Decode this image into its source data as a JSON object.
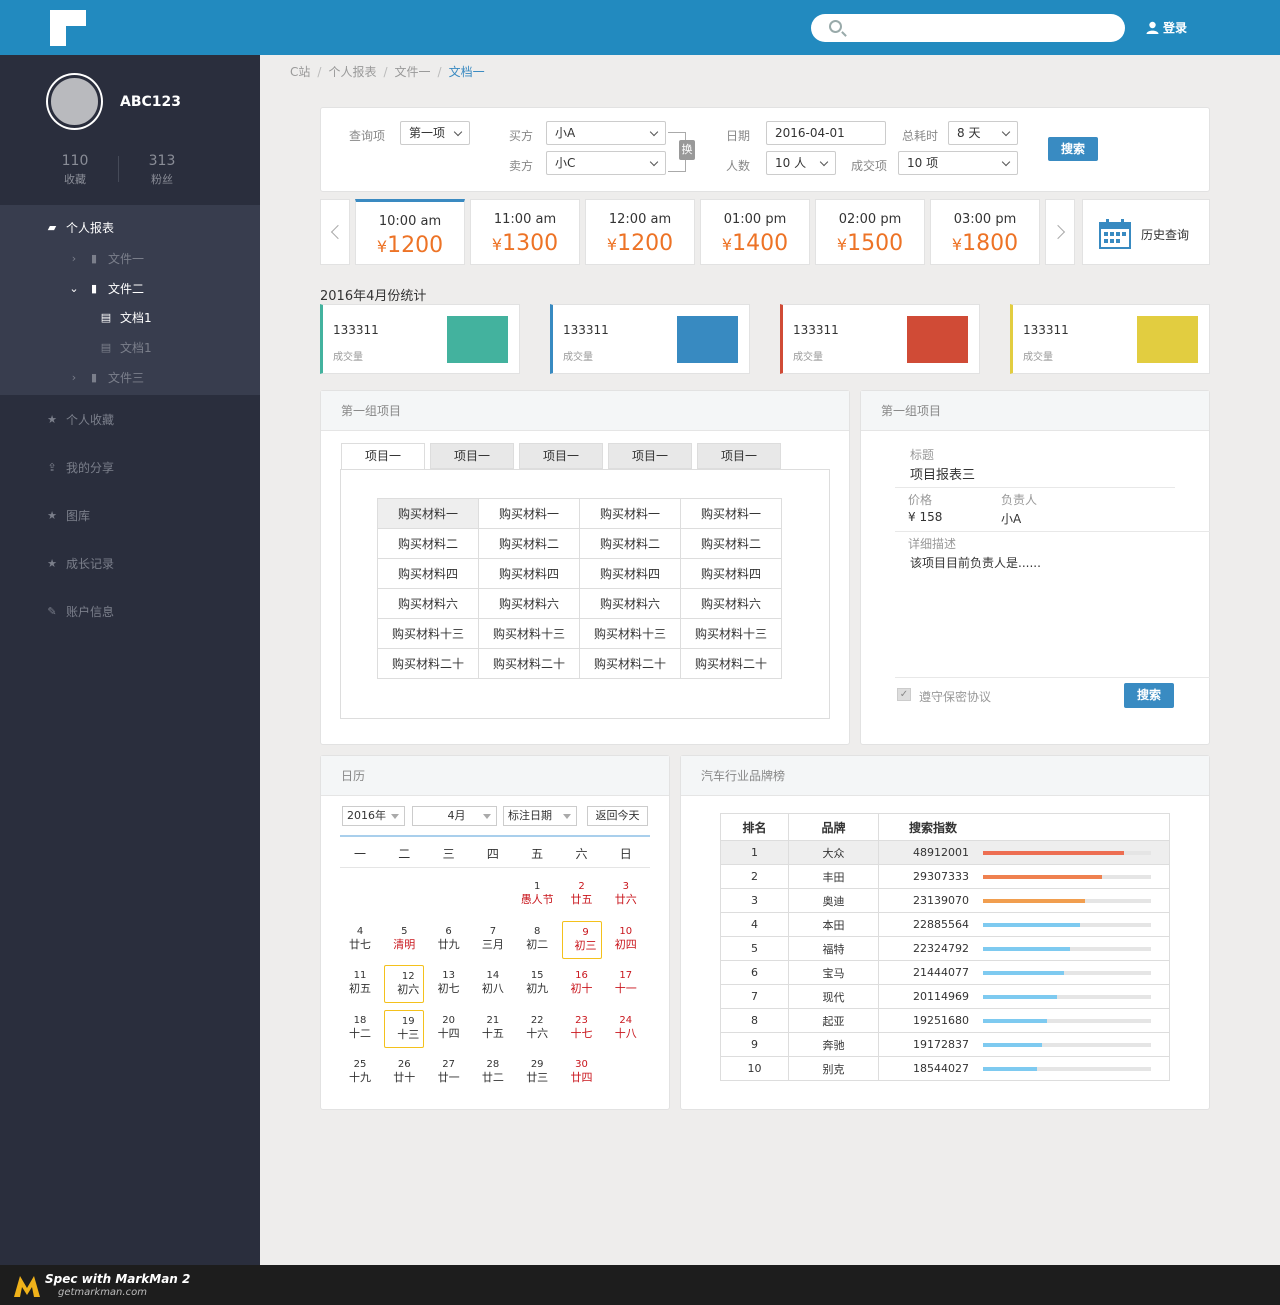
{
  "header": {
    "login_label": "登录",
    "search_placeholder": ""
  },
  "sidebar": {
    "username": "ABC123",
    "stats": [
      {
        "value": "110",
        "label": "收藏"
      },
      {
        "value": "313",
        "label": "粉丝"
      }
    ],
    "menu": {
      "report": "个人报表",
      "file1": "文件一",
      "file2": "文件二",
      "doc1": "文档1",
      "doc2": "文档1",
      "file3": "文件三",
      "favorites": "个人收藏",
      "share": "我的分享",
      "gallery": "图库",
      "growth": "成长记录",
      "account": "账户信息"
    }
  },
  "breadcrumb": {
    "items": [
      "C站",
      "个人报表",
      "文件一"
    ],
    "current": "文档一"
  },
  "query": {
    "label_query": "查询项",
    "query_value": "第一项",
    "label_buyer": "买方",
    "buyer_value": "小A",
    "label_seller": "卖方",
    "seller_value": "小C",
    "swap_label": "换",
    "label_date": "日期",
    "date_value": "2016-04-01",
    "label_duration": "总耗时",
    "duration_value": "8 天",
    "label_people": "人数",
    "people_value": "10 人",
    "label_deals": "成交项",
    "deals_value": "10 项",
    "search_label": "搜索"
  },
  "time_slots": [
    {
      "time": "10:00 am",
      "price": "1200"
    },
    {
      "time": "11:00 am",
      "price": "1300"
    },
    {
      "time": "12:00 am",
      "price": "1200"
    },
    {
      "time": "01:00 pm",
      "price": "1400"
    },
    {
      "time": "02:00 pm",
      "price": "1500"
    },
    {
      "time": "03:00 pm",
      "price": "1800"
    }
  ],
  "currency": "¥",
  "history_label": "历史查询",
  "stats_title": "2016年4月份统计",
  "stat_cards": [
    {
      "value": "133311",
      "label": "成交量",
      "color": "#43b29e"
    },
    {
      "value": "133311",
      "label": "成交量",
      "color": "#388ac1"
    },
    {
      "value": "133311",
      "label": "成交量",
      "color": "#d04b36"
    },
    {
      "value": "133311",
      "label": "成交量",
      "color": "#e2cd40"
    }
  ],
  "group1": {
    "title": "第一组项目",
    "tabs": [
      "项目一",
      "项目一",
      "项目一",
      "项目一",
      "项目一"
    ],
    "rows": [
      [
        "购买材料一",
        "购买材料一",
        "购买材料一",
        "购买材料一"
      ],
      [
        "购买材料二",
        "购买材料二",
        "购买材料二",
        "购买材料二"
      ],
      [
        "购买材料四",
        "购买材料四",
        "购买材料四",
        "购买材料四"
      ],
      [
        "购买材料六",
        "购买材料六",
        "购买材料六",
        "购买材料六"
      ],
      [
        "购买材料十三",
        "购买材料十三",
        "购买材料十三",
        "购买材料十三"
      ],
      [
        "购买材料二十",
        "购买材料二十",
        "购买材料二十",
        "购买材料二十"
      ]
    ]
  },
  "group2": {
    "title": "第一组项目",
    "label_title": "标题",
    "title_value": "项目报表三",
    "label_price": "价格",
    "price_value": "¥ 158",
    "label_owner": "负责人",
    "owner_value": "小A",
    "label_desc": "详细描述",
    "desc_value": "该项目目前负责人是......",
    "agree_label": "遵守保密协议",
    "search_label": "搜索"
  },
  "calendar": {
    "title": "日历",
    "year": "2016年",
    "month": "4月",
    "mark": "标注日期",
    "today": "返回今天",
    "weekdays": [
      "一",
      "二",
      "三",
      "四",
      "五",
      "六",
      "日"
    ],
    "weeks": [
      [
        null,
        null,
        null,
        null,
        {
          "d": "1",
          "l": "愚人节",
          "fest": true
        },
        {
          "d": "2",
          "l": "廿五",
          "red": true
        },
        {
          "d": "3",
          "l": "廿六",
          "red": true
        }
      ],
      [
        {
          "d": "4",
          "l": "廿七"
        },
        {
          "d": "5",
          "l": "清明",
          "fest": true
        },
        {
          "d": "6",
          "l": "廿九"
        },
        {
          "d": "7",
          "l": "三月"
        },
        {
          "d": "8",
          "l": "初二"
        },
        {
          "d": "9",
          "l": "初三",
          "red": true,
          "sel": true
        },
        {
          "d": "10",
          "l": "初四",
          "red": true
        }
      ],
      [
        {
          "d": "11",
          "l": "初五"
        },
        {
          "d": "12",
          "l": "初六",
          "sel": true
        },
        {
          "d": "13",
          "l": "初七"
        },
        {
          "d": "14",
          "l": "初八"
        },
        {
          "d": "15",
          "l": "初九"
        },
        {
          "d": "16",
          "l": "初十",
          "red": true
        },
        {
          "d": "17",
          "l": "十一",
          "red": true
        }
      ],
      [
        {
          "d": "18",
          "l": "十二"
        },
        {
          "d": "19",
          "l": "十三",
          "sel": true
        },
        {
          "d": "20",
          "l": "十四"
        },
        {
          "d": "21",
          "l": "十五"
        },
        {
          "d": "22",
          "l": "十六"
        },
        {
          "d": "23",
          "l": "十七",
          "red": true
        },
        {
          "d": "24",
          "l": "十八",
          "red": true
        }
      ],
      [
        {
          "d": "25",
          "l": "十九"
        },
        {
          "d": "26",
          "l": "廿十"
        },
        {
          "d": "27",
          "l": "廿一"
        },
        {
          "d": "28",
          "l": "廿二"
        },
        {
          "d": "29",
          "l": "廿三"
        },
        {
          "d": "30",
          "l": "廿四",
          "red": true
        },
        null
      ]
    ]
  },
  "brand": {
    "title": "汽车行业品牌榜",
    "headers": [
      "排名",
      "品牌",
      "搜索指数"
    ],
    "rows": [
      {
        "rank": "1",
        "brand": "大众",
        "index": "48912001",
        "ratio": 0.84,
        "color": "#ed6e52"
      },
      {
        "rank": "2",
        "brand": "丰田",
        "index": "29307333",
        "ratio": 0.71,
        "color": "#ef8150"
      },
      {
        "rank": "3",
        "brand": "奥迪",
        "index": "23139070",
        "ratio": 0.61,
        "color": "#f19e4f"
      },
      {
        "rank": "4",
        "brand": "本田",
        "index": "22885564",
        "ratio": 0.58,
        "color": "#7ecaf0"
      },
      {
        "rank": "5",
        "brand": "福特",
        "index": "22324792",
        "ratio": 0.52,
        "color": "#7ecaf0"
      },
      {
        "rank": "6",
        "brand": "宝马",
        "index": "21444077",
        "ratio": 0.48,
        "color": "#7ecaf0"
      },
      {
        "rank": "7",
        "brand": "现代",
        "index": "20114969",
        "ratio": 0.44,
        "color": "#7ecaf0"
      },
      {
        "rank": "8",
        "brand": "起亚",
        "index": "19251680",
        "ratio": 0.38,
        "color": "#7ecaf0"
      },
      {
        "rank": "9",
        "brand": "奔驰",
        "index": "19172837",
        "ratio": 0.35,
        "color": "#7ecaf0"
      },
      {
        "rank": "10",
        "brand": "别克",
        "index": "18544027",
        "ratio": 0.32,
        "color": "#7ecaf0"
      }
    ]
  },
  "footer": {
    "brand": "Spec with MarkMan 2",
    "url": "getmarkman.com"
  }
}
